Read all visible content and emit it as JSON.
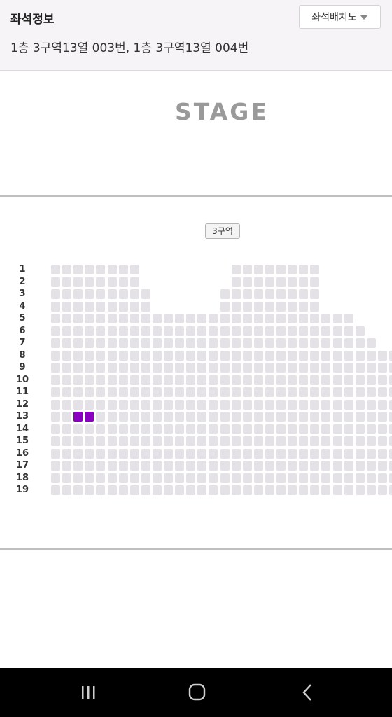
{
  "header": {
    "title": "좌석정보",
    "seat_info": "1층 3구역13열 003번, 1층 3구역13열 004번",
    "layout_button_label": "좌석배치도",
    "layout_button_icon": "caret-down-icon"
  },
  "stage": {
    "label": "STAGE"
  },
  "zone": {
    "label": "3구역"
  },
  "rows": [
    "1",
    "2",
    "3",
    "4",
    "5",
    "6",
    "7",
    "8",
    "9",
    "10",
    "11",
    "12",
    "13",
    "14",
    "15",
    "16",
    "17",
    "18",
    "19"
  ],
  "selected_seats": [
    {
      "row": "13",
      "label": "003번"
    },
    {
      "row": "13",
      "label": "004번"
    }
  ],
  "colors": {
    "selected_seat": "#8a00c0",
    "available_seat": "#e4e2e6",
    "header_bg": "#f7f4f7",
    "navbar_bg": "#000000"
  },
  "navbar": {
    "recents_icon": "recent-apps-icon",
    "home_icon": "home-icon",
    "back_icon": "back-icon"
  }
}
